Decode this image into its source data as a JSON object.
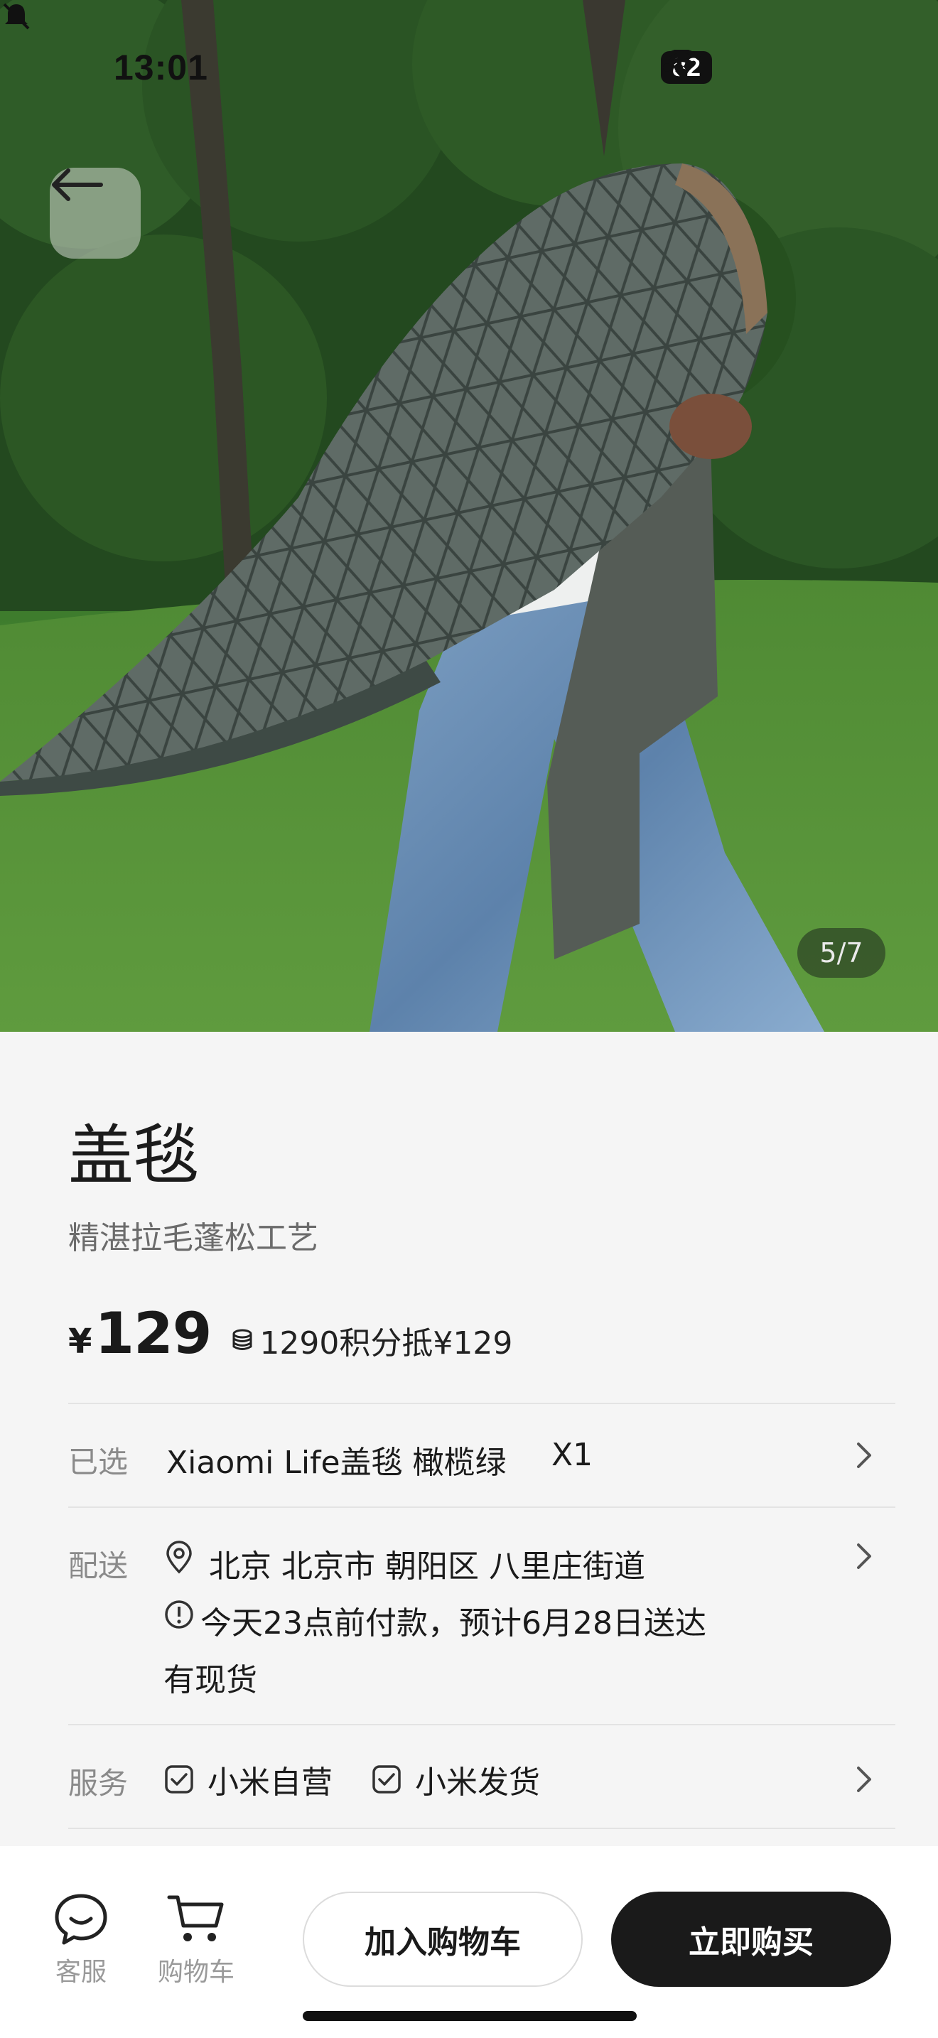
{
  "status_bar": {
    "time": "13:01",
    "battery": "82",
    "icons": [
      "bell-muted-icon",
      "signal-dots-icon",
      "wifi-icon",
      "battery-icon"
    ]
  },
  "gallery": {
    "counter": "5/7",
    "current_index": 5,
    "total": 7,
    "back_icon": "arrow-left-icon"
  },
  "product": {
    "title": "盖毯",
    "subtitle": "精湛拉毛蓬松工艺",
    "price_symbol": "¥",
    "price": "129",
    "points_text": "1290积分抵¥129"
  },
  "selected": {
    "label": "已选",
    "value": "Xiaomi Life盖毯 橄榄绿",
    "quantity": "X1"
  },
  "delivery": {
    "label": "配送",
    "address": "北京 北京市 朝阳区 八里庄街道",
    "eta": "今天23点前付款，预计6月28日送达",
    "stock": "有现货"
  },
  "service": {
    "label": "服务",
    "items": [
      "小米自营",
      "小米发货"
    ]
  },
  "bottom_bar": {
    "customer_service": "客服",
    "cart": "购物车",
    "add_to_cart": "加入购物车",
    "buy_now": "立即购买"
  },
  "colors": {
    "background": "#f5f5f5",
    "buy_button": "#1a1a1a",
    "label_gray": "#8a8a8a",
    "blanket": "#5f6b66"
  }
}
